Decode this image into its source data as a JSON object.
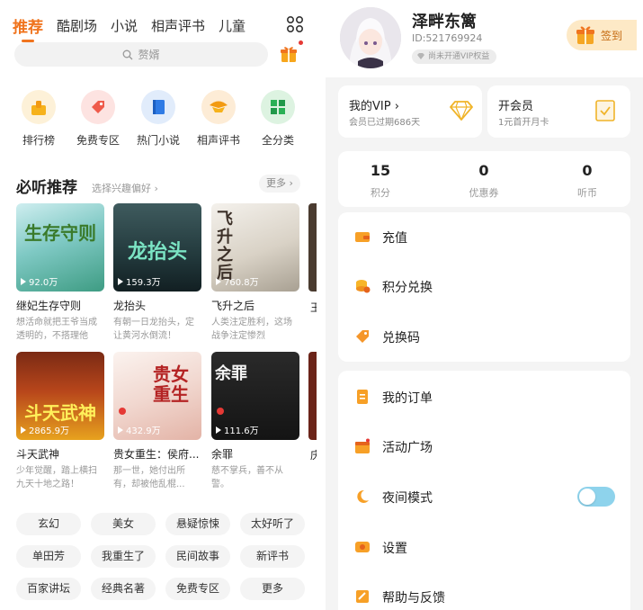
{
  "colors": {
    "accent": "#f0741e",
    "vip_gold": "#f0b429",
    "toggle": "#8ed3ec",
    "badge_red": "#e53935"
  },
  "top_tabs": [
    "推荐",
    "酷剧场",
    "小说",
    "相声评书",
    "儿童"
  ],
  "search": {
    "placeholder": "赘婿",
    "icon": "search-icon"
  },
  "categories": [
    {
      "label": "排行榜",
      "icon": "ranking-icon"
    },
    {
      "label": "免费专区",
      "icon": "free-tag-icon"
    },
    {
      "label": "热门小说",
      "icon": "book-icon"
    },
    {
      "label": "相声评书",
      "icon": "crosstalk-icon"
    },
    {
      "label": "全分类",
      "icon": "grid-icon"
    }
  ],
  "section": {
    "title": "必听推荐",
    "subtitle": "选择兴趣偏好 ›",
    "more": "更多 ›"
  },
  "books": [
    {
      "title": "继妃生存守则",
      "desc": "想活命就把王爷当成透明的，不搭理他",
      "plays": "92.0万",
      "cover_text": "生存守则"
    },
    {
      "title": "龙抬头",
      "desc": "有朝一日龙抬头，定让黄河水倒流！",
      "plays": "159.3万",
      "cover_text": "龙抬头"
    },
    {
      "title": "飞升之后",
      "desc": "人类注定胜利，这场战争注定惨烈",
      "plays": "760.8万",
      "cover_text": "飞升之后"
    },
    {
      "title": "斗天武神",
      "desc": "少年觉醒，踏上横扫九天十地之路！",
      "plays": "2865.9万",
      "cover_text": "斗天武神"
    },
    {
      "title": "贵女重生：侯府...",
      "desc": "那一世，她付出所有，却被他乱棍...",
      "plays": "432.9万",
      "cover_text": "贵女重生"
    },
    {
      "title": "余罪",
      "desc": "慈不掌兵，善不从警。",
      "plays": "111.6万",
      "cover_text": "余罪"
    }
  ],
  "edge_titles": [
    "王",
    "庆"
  ],
  "tags": [
    "玄幻",
    "美女",
    "悬疑惊悚",
    "太好听了",
    "单田芳",
    "我重生了",
    "民间故事",
    "新评书",
    "百家讲坛",
    "经典名著",
    "免费专区",
    "更多"
  ],
  "profile": {
    "name": "泽畔东篱",
    "id": "ID:521769924",
    "vip_badge": "尚未开通VIP权益",
    "sign_in": "签到",
    "sign_in_icon": "gift-box-icon"
  },
  "vip_card": {
    "title": "我的VIP ›",
    "sub": "会员已过期686天",
    "icon": "diamond-icon"
  },
  "member_card": {
    "title": "开会员",
    "sub": "1元首开月卡",
    "icon": "member-card-icon"
  },
  "stats": [
    {
      "value": "15",
      "label": "积分"
    },
    {
      "value": "0",
      "label": "优惠券"
    },
    {
      "value": "0",
      "label": "听币"
    }
  ],
  "menu_group1": [
    {
      "label": "充值",
      "icon": "wallet-icon"
    },
    {
      "label": "积分兑换",
      "icon": "coins-icon"
    },
    {
      "label": "兑换码",
      "icon": "ticket-icon"
    }
  ],
  "menu_group2": [
    {
      "label": "我的订单",
      "icon": "order-icon"
    },
    {
      "label": "活动广场",
      "icon": "activity-icon"
    },
    {
      "label": "夜间模式",
      "icon": "moon-icon",
      "toggle": true
    },
    {
      "label": "设置",
      "icon": "settings-icon"
    },
    {
      "label": "帮助与反馈",
      "icon": "help-icon"
    }
  ]
}
